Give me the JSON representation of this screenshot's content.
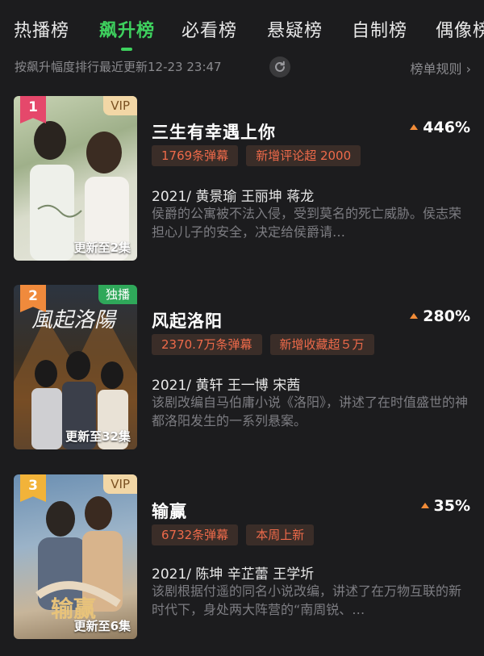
{
  "tabs": [
    {
      "label": "热播榜",
      "active": false
    },
    {
      "label": "飙升榜",
      "active": true
    },
    {
      "label": "必看榜",
      "active": false
    },
    {
      "label": "悬疑榜",
      "active": false
    },
    {
      "label": "自制榜",
      "active": false
    },
    {
      "label": "偶像榜",
      "active": false
    }
  ],
  "subbar": {
    "description": "按飙升幅度排行最近更新12-23 23:47",
    "refresh_icon": "refresh-icon",
    "rules_label": "榜单规则 ›"
  },
  "colors": {
    "accent_green": "#3ed15e",
    "badge_text": "#ee6a4a",
    "vip_gold": "#f2d7a6",
    "exclusive_green": "#2fa85a"
  },
  "items": [
    {
      "rank": "1",
      "rank_color": "#e5486b",
      "corner_tag": "VIP",
      "corner_type": "vip",
      "update": "更新至2集",
      "title": "三生有幸遇上你",
      "rise": "446%",
      "badges": [
        "1769条弹幕",
        "新增评论超 2000"
      ],
      "cast": "2021/ 黄景瑜 王丽坤 蒋龙",
      "synopsis": "侯爵的公寓被不法入侵，受到莫名的死亡威胁。侯志荣担心儿子的安全，决定给侯爵请…"
    },
    {
      "rank": "2",
      "rank_color": "#f08a3c",
      "corner_tag": "独播",
      "corner_type": "excl",
      "update": "更新至32集",
      "title": "风起洛阳",
      "rise": "280%",
      "badges": [
        "2370.7万条弹幕",
        "新增收藏超５万"
      ],
      "cast": "2021/ 黄轩 王一博 宋茜",
      "synopsis": "该剧改编自马伯庸小说《洛阳》，讲述了在时值盛世的神都洛阳发生的一系列悬案。"
    },
    {
      "rank": "3",
      "rank_color": "#f2b339",
      "corner_tag": "VIP",
      "corner_type": "vip",
      "update": "更新至6集",
      "title": "输赢",
      "rise": "35%",
      "badges": [
        "6732条弹幕",
        "本周上新"
      ],
      "cast": "2021/ 陈坤 辛芷蕾 王学圻",
      "synopsis": "该剧根据付遥的同名小说改编，讲述了在万物互联的新时代下，身处两大阵营的“南周锐、…"
    }
  ]
}
